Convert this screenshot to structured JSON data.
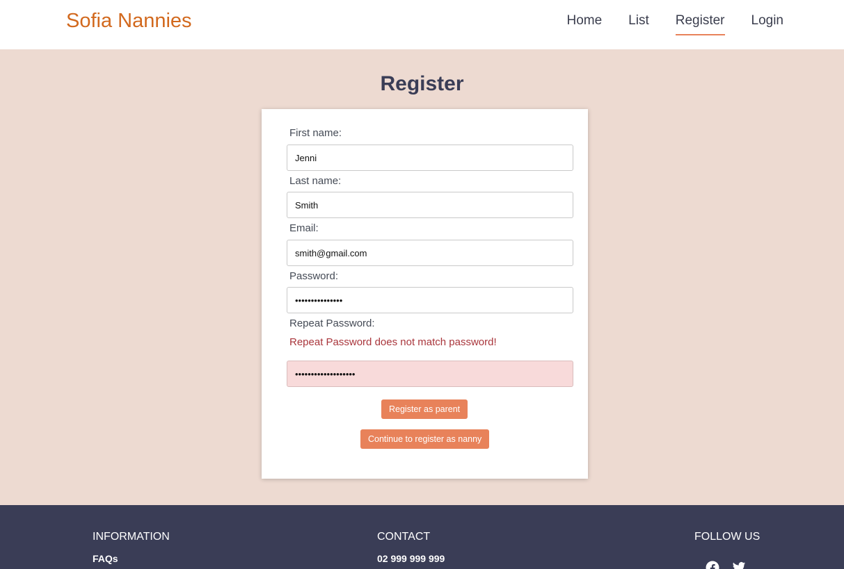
{
  "header": {
    "brand": "Sofia Nannies",
    "nav": [
      {
        "label": "Home",
        "active": false
      },
      {
        "label": "List",
        "active": false
      },
      {
        "label": "Register",
        "active": true
      },
      {
        "label": "Login",
        "active": false
      }
    ]
  },
  "main": {
    "title": "Register",
    "form": {
      "first_name_label": "First name:",
      "first_name_value": "Jenni",
      "last_name_label": "Last name:",
      "last_name_value": "Smith",
      "email_label": "Email:",
      "email_value": "smith@gmail.com",
      "password_label": "Password:",
      "password_value": "•••••••••••••••",
      "repeat_password_label": "Repeat Password:",
      "repeat_password_error": "Repeat Password does not match password!",
      "repeat_password_value": "•••••••••••••••••••",
      "register_parent_label": "Register as parent",
      "register_nanny_label": "Continue to register as nanny"
    }
  },
  "footer": {
    "information_heading": "INFORMATION",
    "faqs_link": "FAQs",
    "contact_heading": "CONTACT",
    "phone": "02 999 999 999",
    "follow_heading": "FOLLOW US",
    "social_icons": [
      "facebook-icon",
      "twitter-icon"
    ]
  },
  "colors": {
    "brand": "#d2691e",
    "accent": "#e8825a",
    "page_bg": "#eddad1",
    "footer_bg": "#3a3d56",
    "error_text": "#a9353b",
    "error_bg": "#f8dada"
  }
}
